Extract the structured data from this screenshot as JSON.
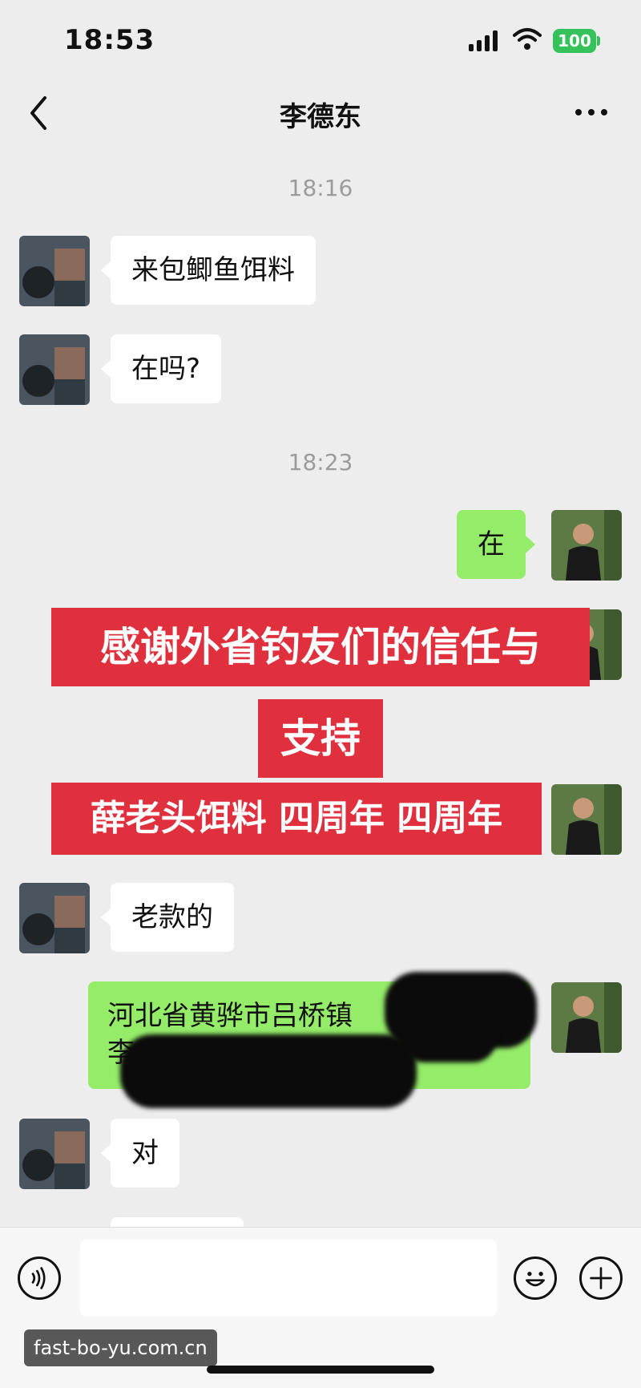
{
  "status_bar": {
    "time": "18:53",
    "battery": "100"
  },
  "header": {
    "title": "李德东"
  },
  "messages": {
    "ts1": "18:16",
    "m1": "来包鲫鱼饵料",
    "m2": "在吗?",
    "ts2": "18:23",
    "m3": "在",
    "m4": "老款的",
    "m5_line1": "河北省黄骅市吕桥镇",
    "m5_line2": "李",
    "m6": "对"
  },
  "banner": {
    "line1": "感谢外省钓友们的信任与",
    "line2": "支持",
    "line3": "薛老头饵料 四周年 四周年"
  },
  "watermark": "fast-bo-yu.com.cn",
  "colors": {
    "accent_green": "#95ec69",
    "banner_red": "#e0303e",
    "battery_green": "#36c25b"
  }
}
